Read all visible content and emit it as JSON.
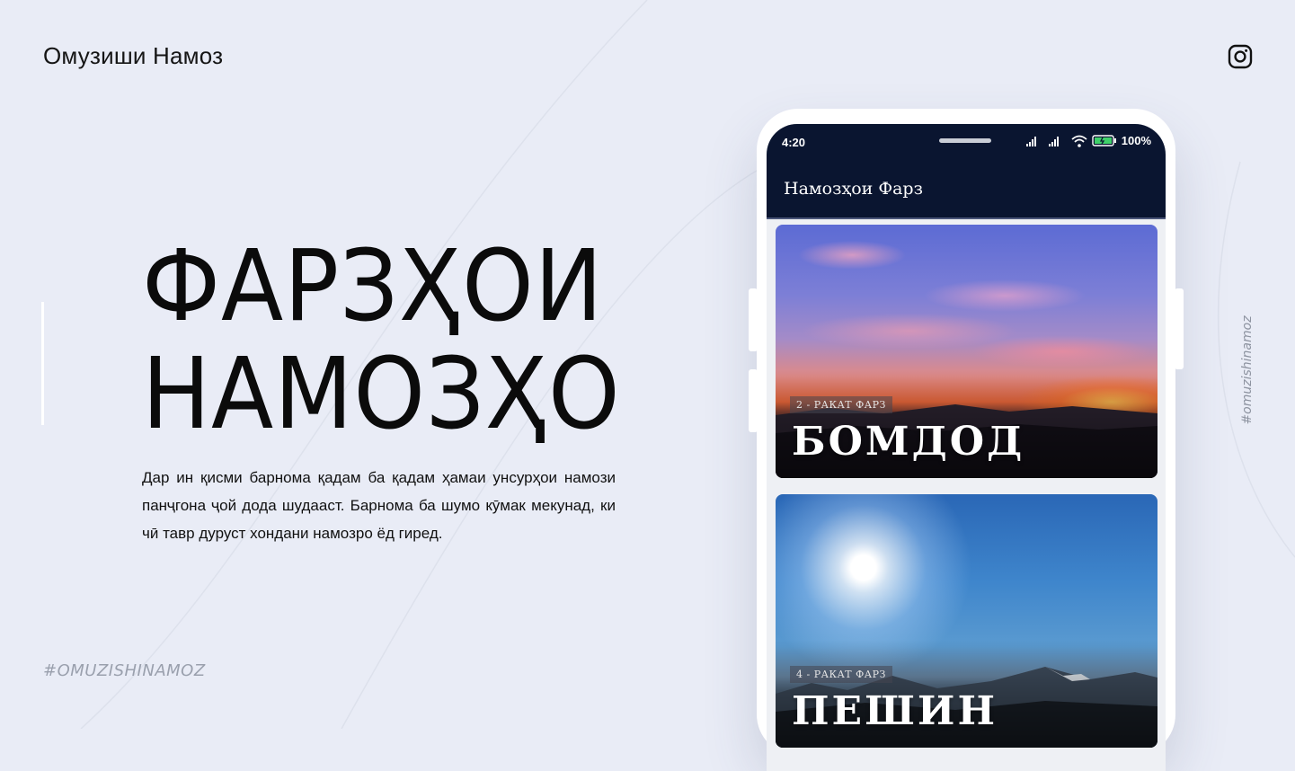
{
  "brand": {
    "title": "Омузиши Намоз"
  },
  "social": {
    "icon": "instagram-icon"
  },
  "hero": {
    "title_line1": "ФАРЗҲОИ",
    "title_line2": "НАМОЗҲО",
    "description": "Дар ин қисми барнома қадам ба қадам ҳамаи унсурҳои намози панҷгона ҷой дода шудааст. Барнома ба шумо кӯмак мекунад, ки чӣ тавр дуруст хондани намозро ёд гиред."
  },
  "hashtags": {
    "bottom": "#OMUZISHINAMOZ",
    "side": "#omuzishinamoz"
  },
  "phone": {
    "status": {
      "time": "4:20",
      "battery": "100%"
    },
    "appbar_title": "Намозҳои Фарз",
    "cards": [
      {
        "label": "2 - РАКАТ ФАРЗ",
        "title": "БОМДОД"
      },
      {
        "label": "4 - РАКАТ ФАРЗ",
        "title": "ПЕШИН"
      }
    ]
  },
  "colors": {
    "background": "#e9ecf6",
    "app_bar": "#0a1530",
    "text": "#111111"
  }
}
